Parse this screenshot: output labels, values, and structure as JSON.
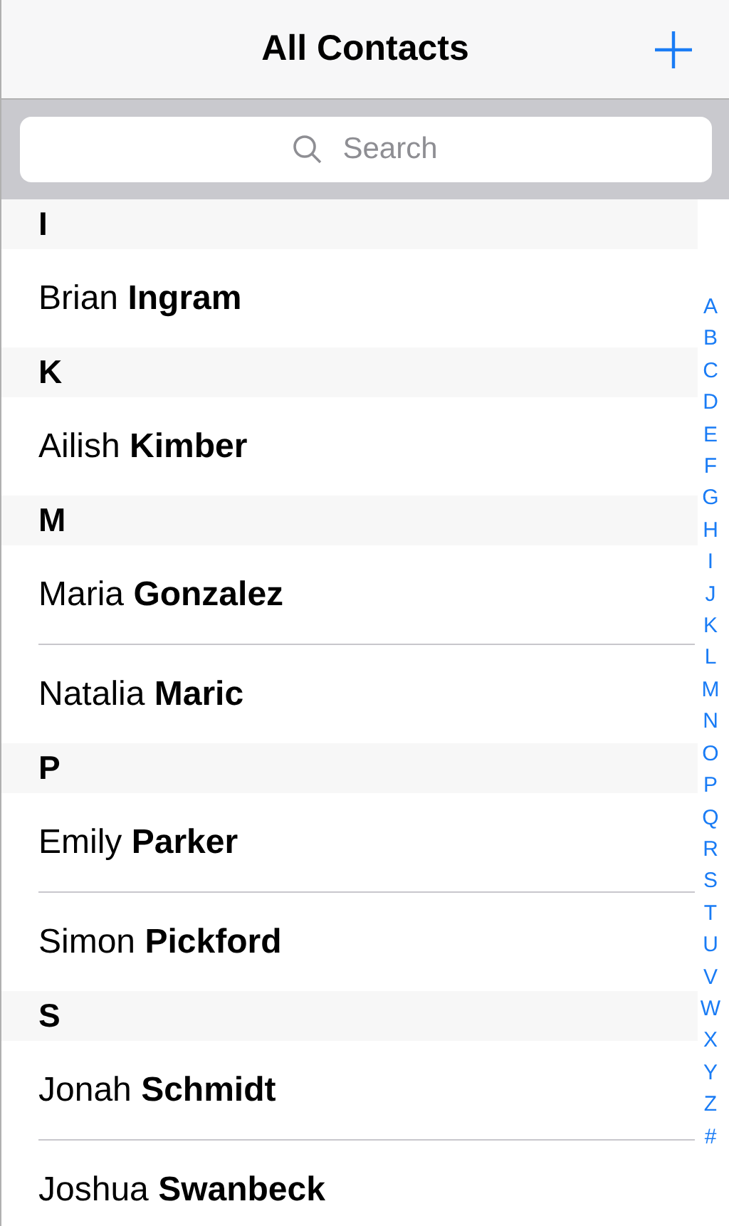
{
  "nav": {
    "title": "All Contacts"
  },
  "search": {
    "placeholder": "Search"
  },
  "sections": [
    {
      "letter": "I",
      "contacts": [
        "Brian **Ingram**"
      ]
    },
    {
      "letter": "K",
      "contacts": [
        "Ailish **Kimber**"
      ]
    },
    {
      "letter": "M",
      "contacts": [
        "Maria **Gonzalez**",
        "Natalia **Maric**"
      ]
    },
    {
      "letter": "P",
      "contacts": [
        "Emily **Parker**",
        "Simon **Pickford**"
      ]
    },
    {
      "letter": "S",
      "contacts": [
        "Jonah **Schmidt**",
        "Joshua **Swanbeck**"
      ]
    }
  ],
  "index": [
    "A",
    "B",
    "C",
    "D",
    "E",
    "F",
    "G",
    "H",
    "I",
    "J",
    "K",
    "L",
    "M",
    "N",
    "O",
    "P",
    "Q",
    "R",
    "S",
    "T",
    "U",
    "V",
    "W",
    "X",
    "Y",
    "Z",
    "#"
  ]
}
